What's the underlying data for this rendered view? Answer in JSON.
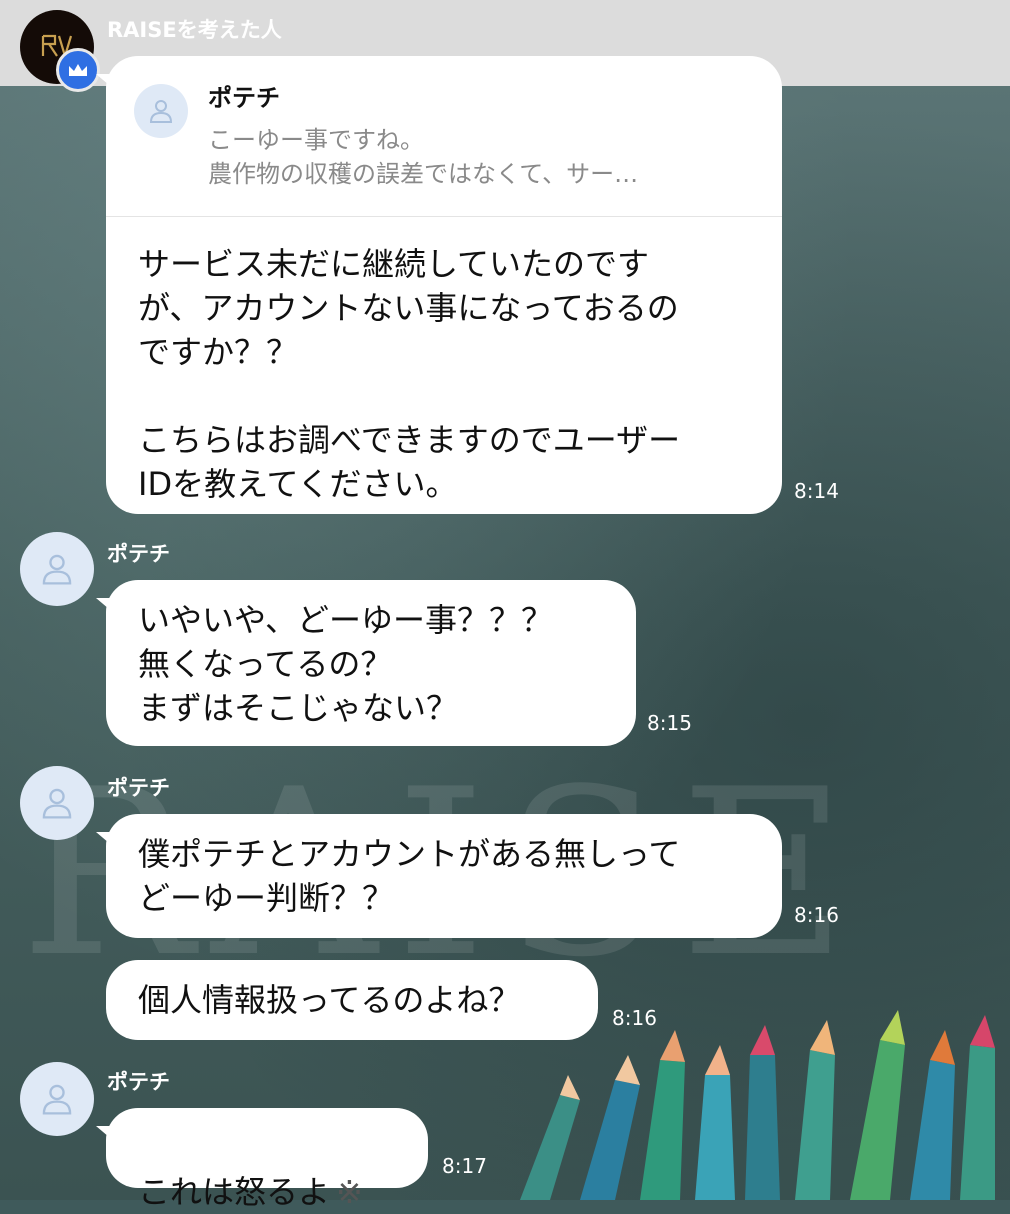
{
  "header": {
    "sender_name": "RAISEを考えた人",
    "logo_text": "RAISE"
  },
  "messages": [
    {
      "sender": "RAISEを考えた人",
      "reply": {
        "name": "ポテチ",
        "line1": "こーゆー事ですね。",
        "line2": "農作物の収穫の誤差ではなくて、サー…"
      },
      "text": "サービス未だに継続していたのです\nが、アカウントない事になっておるの\nですか？？\n\nこちらはお調べできますのでユーザー\nIDを教えてください。",
      "time": "8:14"
    },
    {
      "sender": "ポテチ",
      "text": "いやいや、どーゆー事？？？\n無くなってるの？\nまずはそこじゃない？",
      "time": "8:15"
    },
    {
      "sender": "ポテチ",
      "text": "僕ポテチとアカウントがある無しって\nどーゆー判断？？",
      "time": "8:16"
    },
    {
      "text": "個人情報扱ってるのよね？",
      "time": "8:16"
    },
    {
      "sender": "ポテチ",
      "text": "これは怒るよ",
      "emoji": "※",
      "time": "8:17"
    }
  ],
  "icons": {
    "crown": "crown-icon",
    "default_avatar": "person-icon"
  },
  "colors": {
    "crown_badge": "#2f6fe3",
    "avatar_bg": "#dfe9f6",
    "bubble": "#ffffff"
  }
}
